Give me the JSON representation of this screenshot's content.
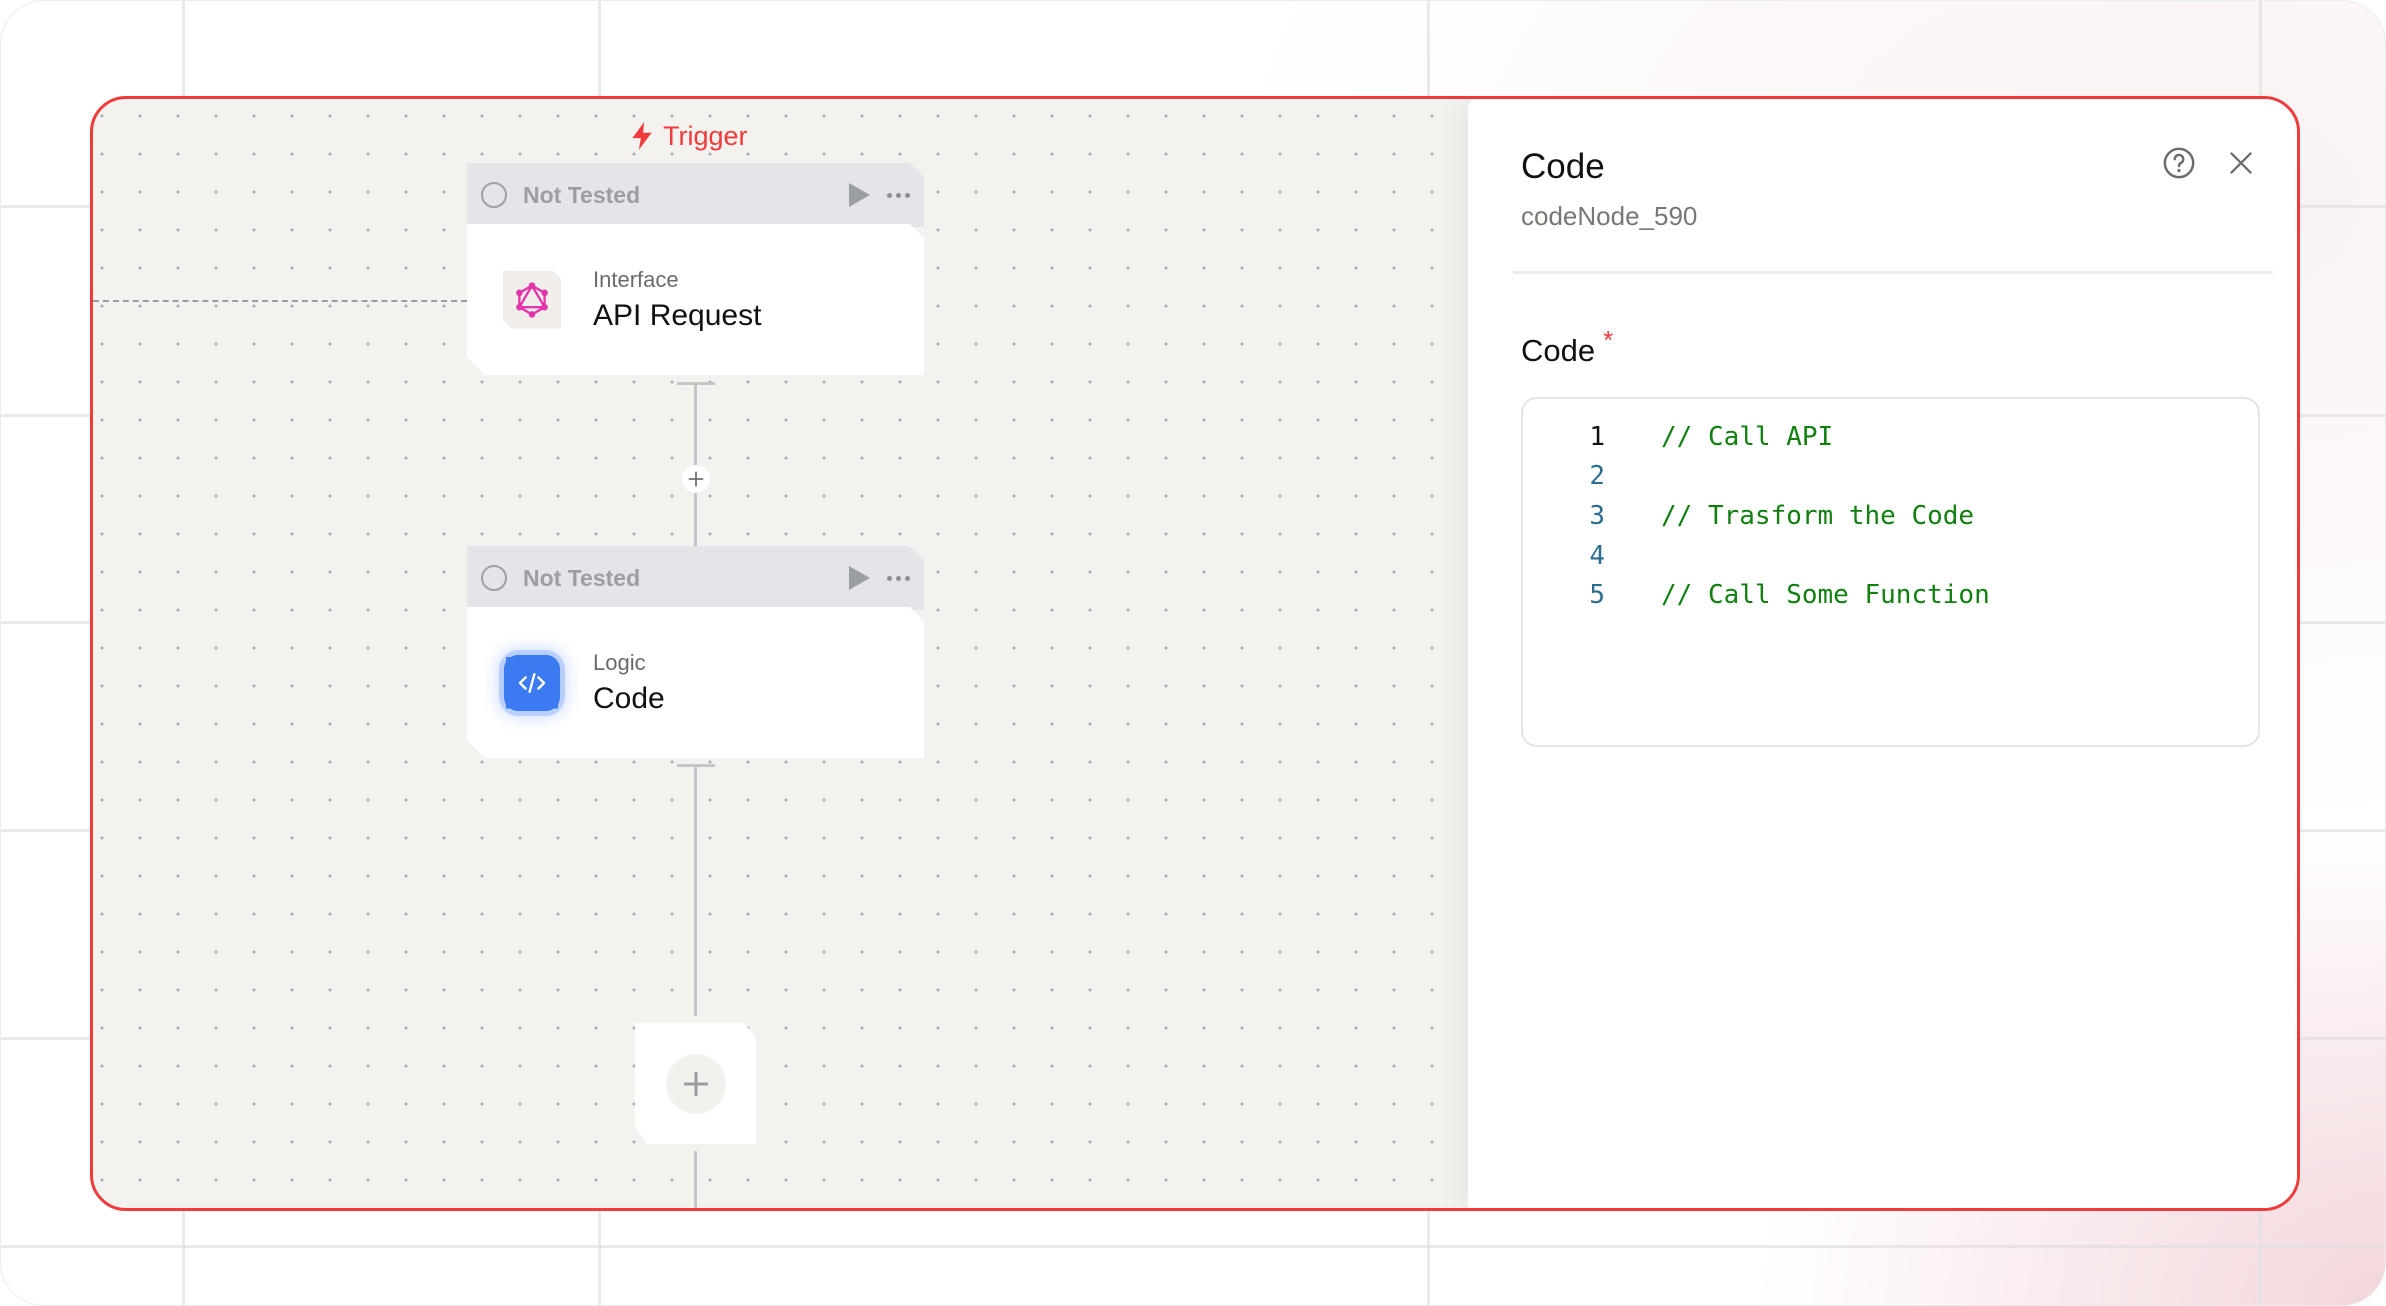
{
  "canvas": {
    "trigger_label": "Trigger",
    "nodes": [
      {
        "status": "Not Tested",
        "category": "Interface",
        "title": "API Request",
        "icon": "graphql-icon"
      },
      {
        "status": "Not Tested",
        "category": "Logic",
        "title": "Code",
        "icon": "code-brackets-icon"
      }
    ],
    "insert_button_label": "+",
    "add_node_icon": "plus-icon"
  },
  "panel": {
    "title": "Code",
    "node_id": "codeNode_590",
    "help_icon": "help-circle-icon",
    "close_icon": "close-icon",
    "field": {
      "label": "Code",
      "required_marker": "*",
      "lines": [
        {
          "number": "1",
          "code": "// Call API"
        },
        {
          "number": "2",
          "code": ""
        },
        {
          "number": "3",
          "code": "// Trasform the Code"
        },
        {
          "number": "4",
          "code": ""
        },
        {
          "number": "5",
          "code": "// Call Some Function"
        }
      ]
    }
  },
  "colors": {
    "accent_red": "#EF3B3B",
    "code_comment": "#118011",
    "line_number": "#2C6E8E",
    "code_icon_blue": "#3B7AF0",
    "graphql_pink": "#E535AB",
    "canvas_bg": "#F3F2EF"
  }
}
